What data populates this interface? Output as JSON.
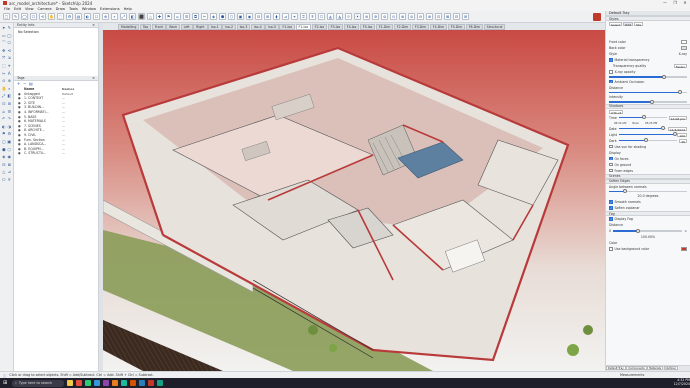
{
  "window": {
    "title": "arc_model_architecture* - SketchUp 2024",
    "controls": [
      "—",
      "❐",
      "✕"
    ]
  },
  "menu": [
    "File",
    "Edit",
    "View",
    "Camera",
    "Draw",
    "Tools",
    "Window",
    "Extensions",
    "Help"
  ],
  "scenes": {
    "tabs": [
      "Modelling",
      "Top",
      "Front",
      "Back",
      "Left",
      "Right",
      "Iso-1",
      "Iso-2",
      "Iso-3",
      "Iso-4",
      "Iso-5",
      "F1-Iso",
      "F1-Iso",
      "F2-Iso",
      "F3-Iso",
      "F4-Iso",
      "F5-Iso",
      "F1-Dim",
      "F2-Dim",
      "F3-Dim",
      "F4-Dim",
      "F5-Dim",
      "F6-Dim",
      "Structural"
    ],
    "active_index": 12
  },
  "entity_info": {
    "title": "Entity Info",
    "selection": "No Selection"
  },
  "tags": {
    "title": "Tags",
    "columns": [
      "Name",
      "Dashes"
    ],
    "rows": [
      {
        "name": "Untagged",
        "dashes": "Default"
      },
      {
        "name": "1. CONTEXT",
        "dashes": "—"
      },
      {
        "name": "2. SITE",
        "dashes": "—"
      },
      {
        "name": "3. BUILDIN...",
        "dashes": "—"
      },
      {
        "name": "4. INFORMATI...",
        "dashes": "—"
      },
      {
        "name": "5. BASE",
        "dashes": "—"
      },
      {
        "name": "6. MATERIALS",
        "dashes": "—"
      },
      {
        "name": "7. SCENES",
        "dashes": "—"
      },
      {
        "name": "8. ARCHITE...",
        "dashes": "—"
      },
      {
        "name": "9. CIVIL",
        "dashes": "—"
      },
      {
        "name": "Furn. Section",
        "dashes": "—"
      },
      {
        "name": "A. LANDSCA...",
        "dashes": "—"
      },
      {
        "name": "B. EQUIPM...",
        "dashes": "—"
      },
      {
        "name": "C. STRUCTU...",
        "dashes": "—"
      }
    ]
  },
  "default_tray": {
    "title": "Default Tray",
    "styles": {
      "title": "Styles",
      "tabs": [
        "Select",
        "Edit",
        "Mix"
      ],
      "active_tab": 1,
      "front_color_label": "Front color",
      "back_color_label": "Back color",
      "style_label": "Style",
      "style_value": "X-ray",
      "material_transparency_label": "Material transparency",
      "transparency_quality_label": "Transparency quality",
      "transparency_quality_value": "Faster",
      "x_ray_label": "X-ray opacity",
      "ambient_occlusion_label": "Ambient Occlusion",
      "distance_label": "Distance",
      "intensity_label": "Intensity"
    },
    "shadows": {
      "title": "Shadows",
      "utc_label": "UTC+5",
      "time_label": "Time",
      "time_start": "06:34 AM",
      "time_noon": "Noon",
      "time_end": "05:25 PM",
      "time_value": "12:08 pm",
      "date_label": "Date",
      "date_value": "12/4/2024",
      "light_label": "Light",
      "light_value": "100",
      "dark_label": "Dark",
      "dark_value": "45",
      "use_sun_label": "Use sun for shading",
      "display_label": "Display",
      "on_faces_label": "On faces",
      "on_ground_label": "On ground",
      "from_edges_label": "From edges"
    },
    "scenes_label": "Scenes",
    "soften_edges": {
      "title": "Soften Edges",
      "angle_label": "Angle between normals",
      "angle_value": "20.0 degrees",
      "smooth_normals": "Smooth normals",
      "soften_coplanar": "Soften coplanar"
    },
    "fog": {
      "title": "Fog",
      "display_fog": "Display Fog",
      "distance_label": "Distance",
      "distance_start": "0",
      "distance_end": "∞",
      "percent": "100.00%",
      "color_label": "Color",
      "use_bg_color": "Use background color",
      "fog_color": "#c0392b"
    },
    "bottom_tabs": [
      "Default Tray",
      "Components",
      "Materials",
      "Outliner"
    ]
  },
  "status": {
    "hint": "Click or drag to select objects. Shift = Add/Subtract. Ctrl = Add. Shift + Ctrl = Subtract.",
    "measurements_label": "Measurements"
  },
  "taskbar": {
    "search_placeholder": "Type here to search",
    "time": "4:32 PM",
    "date": "12/7/2024",
    "app_colors": [
      "#f2c94c",
      "#e74c3c",
      "#2ecc71",
      "#3498db",
      "#8e44ad",
      "#e67e22",
      "#1abc9c",
      "#d35400",
      "#2980b9",
      "#c0392b",
      "#16a085"
    ]
  }
}
